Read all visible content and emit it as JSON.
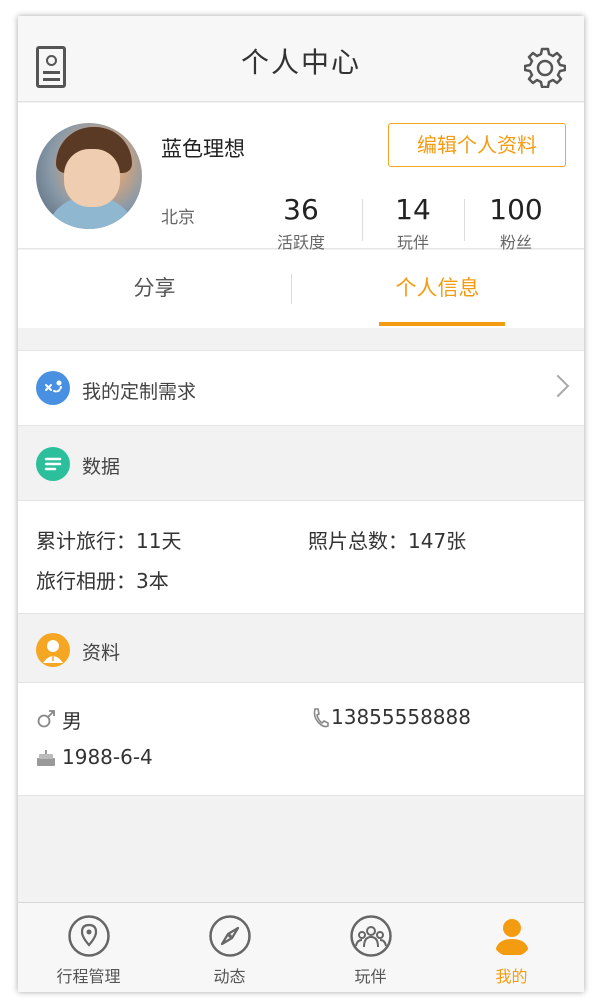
{
  "header": {
    "title": "个人中心",
    "left_icon": "profile-card-icon",
    "right_icon": "gear-icon"
  },
  "profile": {
    "name": "蓝色理想",
    "city": "北京",
    "edit_label": "编辑个人资料",
    "stats": [
      {
        "value": "36",
        "label": "活跃度"
      },
      {
        "value": "14",
        "label": "玩伴"
      },
      {
        "value": "100",
        "label": "粉丝"
      }
    ]
  },
  "tabs": [
    {
      "label": "分享",
      "active": false
    },
    {
      "label": "个人信息",
      "active": true
    }
  ],
  "custom_request": {
    "label": "我的定制需求",
    "icon": "custom-request-icon"
  },
  "data_section": {
    "title": "数据",
    "icon": "list-icon",
    "total_trips": "累计旅行：11天",
    "total_photos": "照片总数：147张",
    "albums": "旅行相册：3本"
  },
  "profile_section": {
    "title": "资料",
    "icon": "person-icon",
    "gender": "男",
    "phone": "13855558888",
    "birthday": "1988-6-4"
  },
  "bottom_nav": [
    {
      "label": "行程管理",
      "icon": "location-pin-icon",
      "active": false
    },
    {
      "label": "动态",
      "icon": "compass-icon",
      "active": false
    },
    {
      "label": "玩伴",
      "icon": "group-icon",
      "active": false
    },
    {
      "label": "我的",
      "icon": "user-icon",
      "active": true
    }
  ],
  "colors": {
    "accent": "#f39c12",
    "blue_icon": "#4a90e2",
    "teal_icon": "#2bbf9c",
    "orange_icon": "#f5a623"
  }
}
